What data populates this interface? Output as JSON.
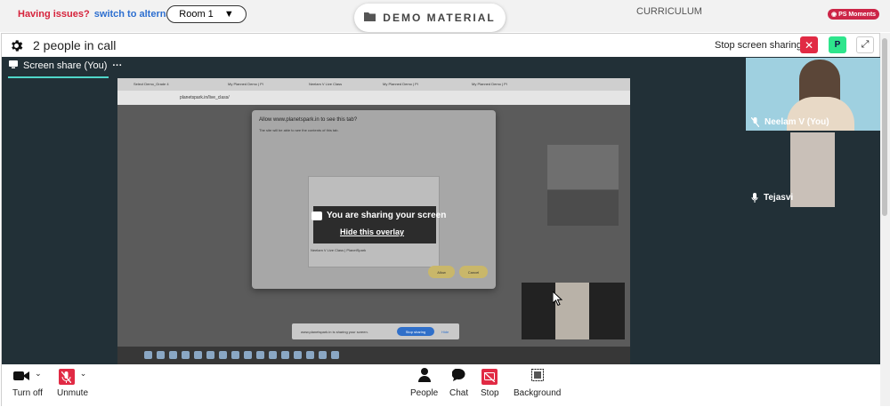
{
  "topbar": {
    "issues_text": "Having issues?",
    "switch_link": "switch to alternate room",
    "room_select": "Room 1",
    "demo_material": "DEMO MATERIAL",
    "curriculum": "CURRICULUM",
    "ps_moments": "PS Moments"
  },
  "call": {
    "title": "2 people in call",
    "stop_sharing": "Stop screen sharing",
    "profile_initial": "P"
  },
  "stage": {
    "share_label": "Screen share (You)",
    "dialog_title": "Allow www.planetspark.in to see this tab?",
    "dialog_sub": "The site will be able to see the contents of this tab.",
    "sharing_banner": "You are sharing your screen",
    "hide_overlay": "Hide this overlay",
    "preview_tab": "Neelam V  Live Class | PlanetSpark",
    "allow": "Allow",
    "cancel": "Cancel",
    "chrome_tabs": [
      "Select Demo_Grade 4",
      "My Planned Demo | Pl",
      "Neelam V  Live Class",
      "My Planned Demo | Pl",
      "My Planned Demo | Pl"
    ],
    "address": "planetspark.in/live_class/",
    "notice_text": "www.planetspark.in is sharing your screen.",
    "notice_stop": "Stop sharing",
    "notice_hide": "Hide"
  },
  "participants": [
    {
      "name": "Neelam V (You)"
    },
    {
      "name": "Tejasvi"
    }
  ],
  "controls": {
    "turn_off": "Turn off",
    "unmute": "Unmute",
    "people": "People",
    "chat": "Chat",
    "stop": "Stop",
    "background": "Background"
  },
  "icons": {
    "settings": "gear-icon",
    "camera": "video-camera-icon",
    "mic_off": "microphone-off-icon",
    "people": "person-icon",
    "chat": "chat-bubble-icon",
    "stop": "screen-share-stop-icon",
    "background": "background-icon",
    "expand": "expand-icon",
    "folder": "folder-icon"
  }
}
